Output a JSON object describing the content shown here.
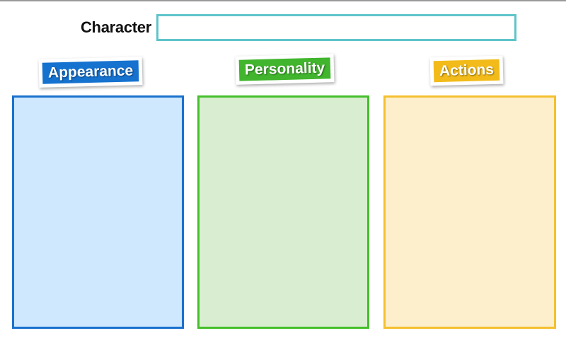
{
  "character": {
    "label": "Character",
    "value": "",
    "border_color": "#5ec4c9"
  },
  "columns": [
    {
      "title": "Appearance",
      "tag_color": "#1572cf",
      "panel_fill": "#cfe8fd",
      "panel_border": "#1a71cd"
    },
    {
      "title": "Personality",
      "tag_color": "#41b52d",
      "panel_fill": "#d9eed0",
      "panel_border": "#45bf2b"
    },
    {
      "title": "Actions",
      "tag_color": "#f2bb1a",
      "panel_fill": "#fdeecc",
      "panel_border": "#f4c02f"
    }
  ]
}
